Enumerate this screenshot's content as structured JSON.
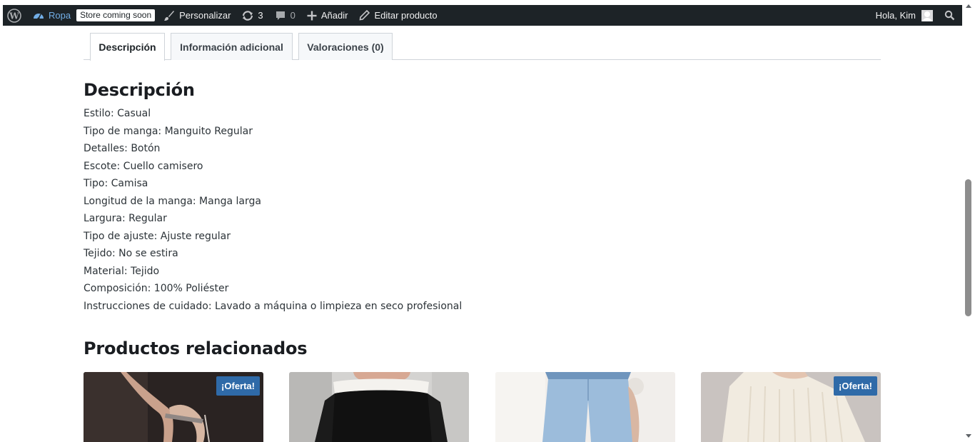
{
  "admin_bar": {
    "site_name": "Ropa",
    "store_badge": "Store coming soon",
    "customize": "Personalizar",
    "updates_count": "3",
    "comments_count": "0",
    "add_new": "Añadir",
    "edit_product": "Editar producto",
    "greeting": "Hola, Kim"
  },
  "tabs": [
    {
      "label": "Descripción",
      "active": true
    },
    {
      "label": "Información adicional",
      "active": false
    },
    {
      "label": "Valoraciones (0)",
      "active": false
    }
  ],
  "description": {
    "heading": "Descripción",
    "lines": [
      "Estilo: Casual",
      "Tipo de manga: Manguito Regular",
      "Detalles: Botón",
      "Escote: Cuello camisero",
      "Tipo: Camisa",
      "Longitud de la manga: Manga larga",
      "Largura: Regular",
      "Tipo de ajuste: Ajuste regular",
      "Tejido: No se estira",
      "Material: Tejido",
      "Composición: 100% Poliéster",
      "Instrucciones de cuidado: Lavado a máquina o limpieza en seco profesional"
    ]
  },
  "related": {
    "heading": "Productos relacionados",
    "products": [
      {
        "badge": "¡Oferta!",
        "image": "heels-photo"
      },
      {
        "badge": "",
        "image": "off-shoulder-top-photo"
      },
      {
        "badge": "",
        "image": "jeans-photo"
      },
      {
        "badge": "¡Oferta!",
        "image": "knit-sweater-photo"
      }
    ]
  },
  "colors": {
    "admin_bar": "#1d2327",
    "site_link": "#72aee6",
    "badge": "#2f6aa8"
  }
}
